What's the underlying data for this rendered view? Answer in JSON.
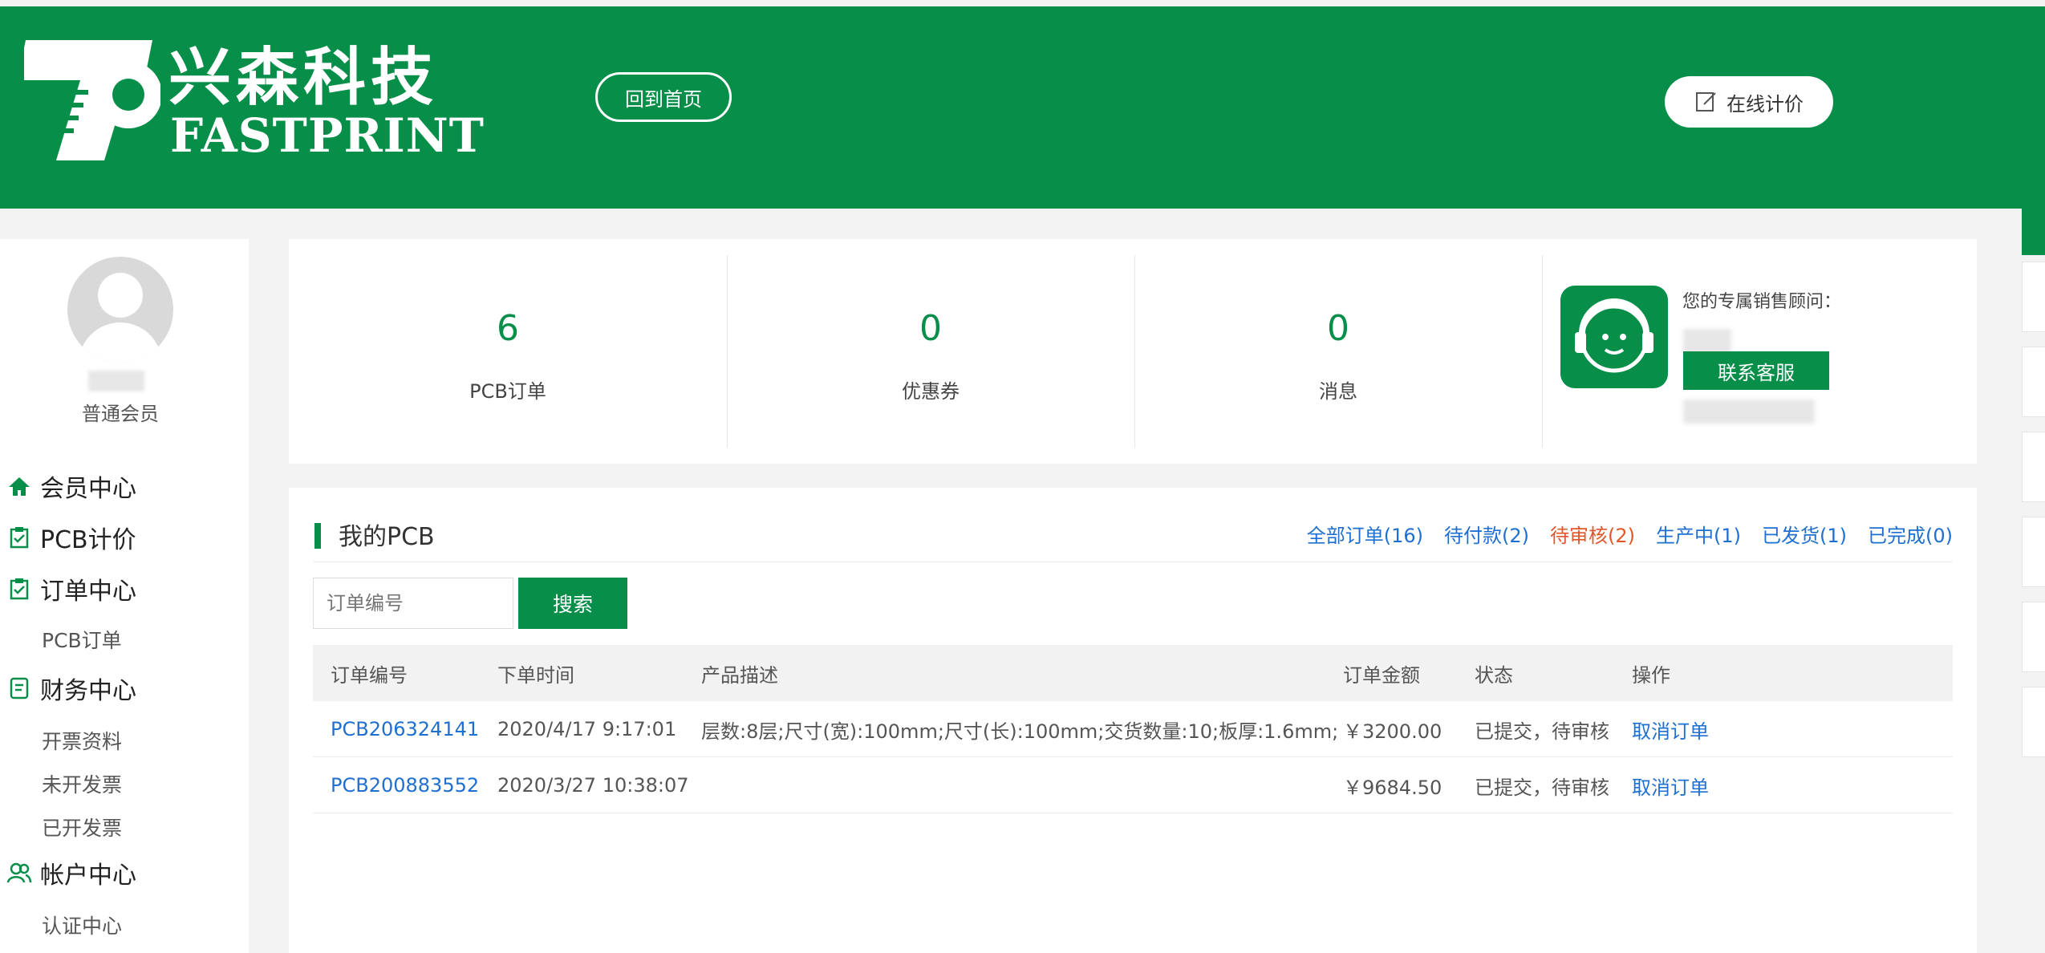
{
  "header": {
    "brand_cn": "兴森科技",
    "brand_en": "FASTPRINT",
    "home_button": "回到首页",
    "quote_button": "在线计价",
    "quote_icon": "edit-icon"
  },
  "colors": {
    "brand_green": "#078f4a",
    "link_blue": "#1f6fd1",
    "alert_red": "#e0572b"
  },
  "sidebar": {
    "member_level": "普通会员",
    "menu": [
      {
        "label": "会员中心",
        "icon": "home-icon",
        "type": "main"
      },
      {
        "label": "PCB计价",
        "icon": "clipboard-check-icon",
        "type": "main"
      },
      {
        "label": "订单中心",
        "icon": "clipboard-check-icon",
        "type": "main"
      },
      {
        "label": "PCB订单",
        "type": "sub"
      },
      {
        "label": "财务中心",
        "icon": "document-icon",
        "type": "main"
      },
      {
        "label": "开票资料",
        "type": "sub"
      },
      {
        "label": "未开发票",
        "type": "sub"
      },
      {
        "label": "已开发票",
        "type": "sub"
      },
      {
        "label": "帐户中心",
        "icon": "users-icon",
        "type": "main"
      },
      {
        "label": "认证中心",
        "type": "sub"
      }
    ]
  },
  "stats": [
    {
      "value": "6",
      "label": "PCB订单"
    },
    {
      "value": "0",
      "label": "优惠券"
    },
    {
      "value": "0",
      "label": "消息"
    }
  ],
  "advisor": {
    "title": "您的专属销售顾问：",
    "contact_button": "联系客服",
    "icon": "customer-service-icon"
  },
  "orders": {
    "title": "我的PCB",
    "filters": [
      {
        "label": "全部订单(16)",
        "color": "#1f6fd1"
      },
      {
        "label": "待付款(2)",
        "color": "#1f6fd1"
      },
      {
        "label": "待审核(2)",
        "color": "#e0572b"
      },
      {
        "label": "生产中(1)",
        "color": "#1f6fd1"
      },
      {
        "label": "已发货(1)",
        "color": "#1f6fd1"
      },
      {
        "label": "已完成(0)",
        "color": "#1f6fd1"
      }
    ],
    "search_placeholder": "订单编号",
    "search_button": "搜索",
    "columns": [
      "订单编号",
      "下单时间",
      "产品描述",
      "订单金额",
      "状态",
      "操作"
    ],
    "rows": [
      {
        "order_no": "PCB206324141",
        "time": "2020/4/17 9:17:01",
        "desc": "层数:8层;尺寸(宽):100mm;尺寸(长):100mm;交货数量:10;板厚:1.6mm;",
        "amount": "￥3200.00",
        "status": "已提交，待审核",
        "action": "取消订单"
      },
      {
        "order_no": "PCB200883552",
        "time": "2020/3/27 10:38:07",
        "desc": "",
        "amount": "￥9684.50",
        "status": "已提交，待审核",
        "action": "取消订单"
      }
    ]
  }
}
